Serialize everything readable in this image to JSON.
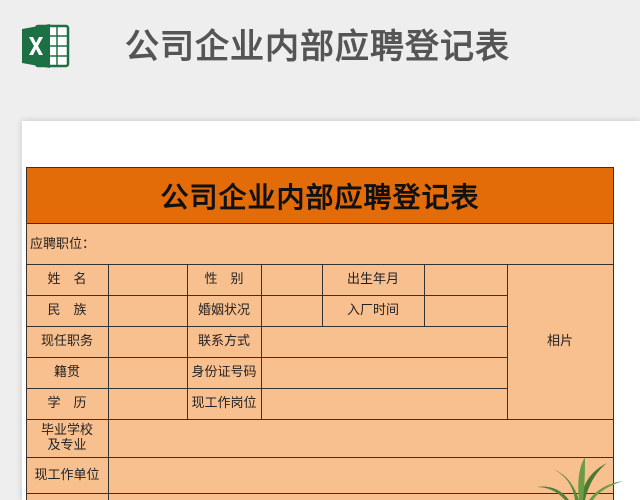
{
  "header": {
    "title": "公司企业内部应聘登记表",
    "icon": "excel-icon",
    "icon_color": "#1d7044"
  },
  "form": {
    "title": "公司企业内部应聘登记表",
    "banner_color": "#e36c09",
    "body_color": "#f9c08f",
    "position_applied_label": "应聘职位：",
    "labels": {
      "name": "姓　名",
      "gender": "性　别",
      "birth": "出生年月",
      "ethnicity": "民　族",
      "marital": "婚姻状况",
      "factory_date": "入厂时间",
      "current_post": "现任职务",
      "contact": "联系方式",
      "photo": "相片",
      "native_place": "籍贯",
      "id_number": "身份证号码",
      "education": "学　历",
      "current_job_post": "现工作岗位",
      "school_major": "毕业学校及专业",
      "current_employer": "现工作单位"
    }
  }
}
